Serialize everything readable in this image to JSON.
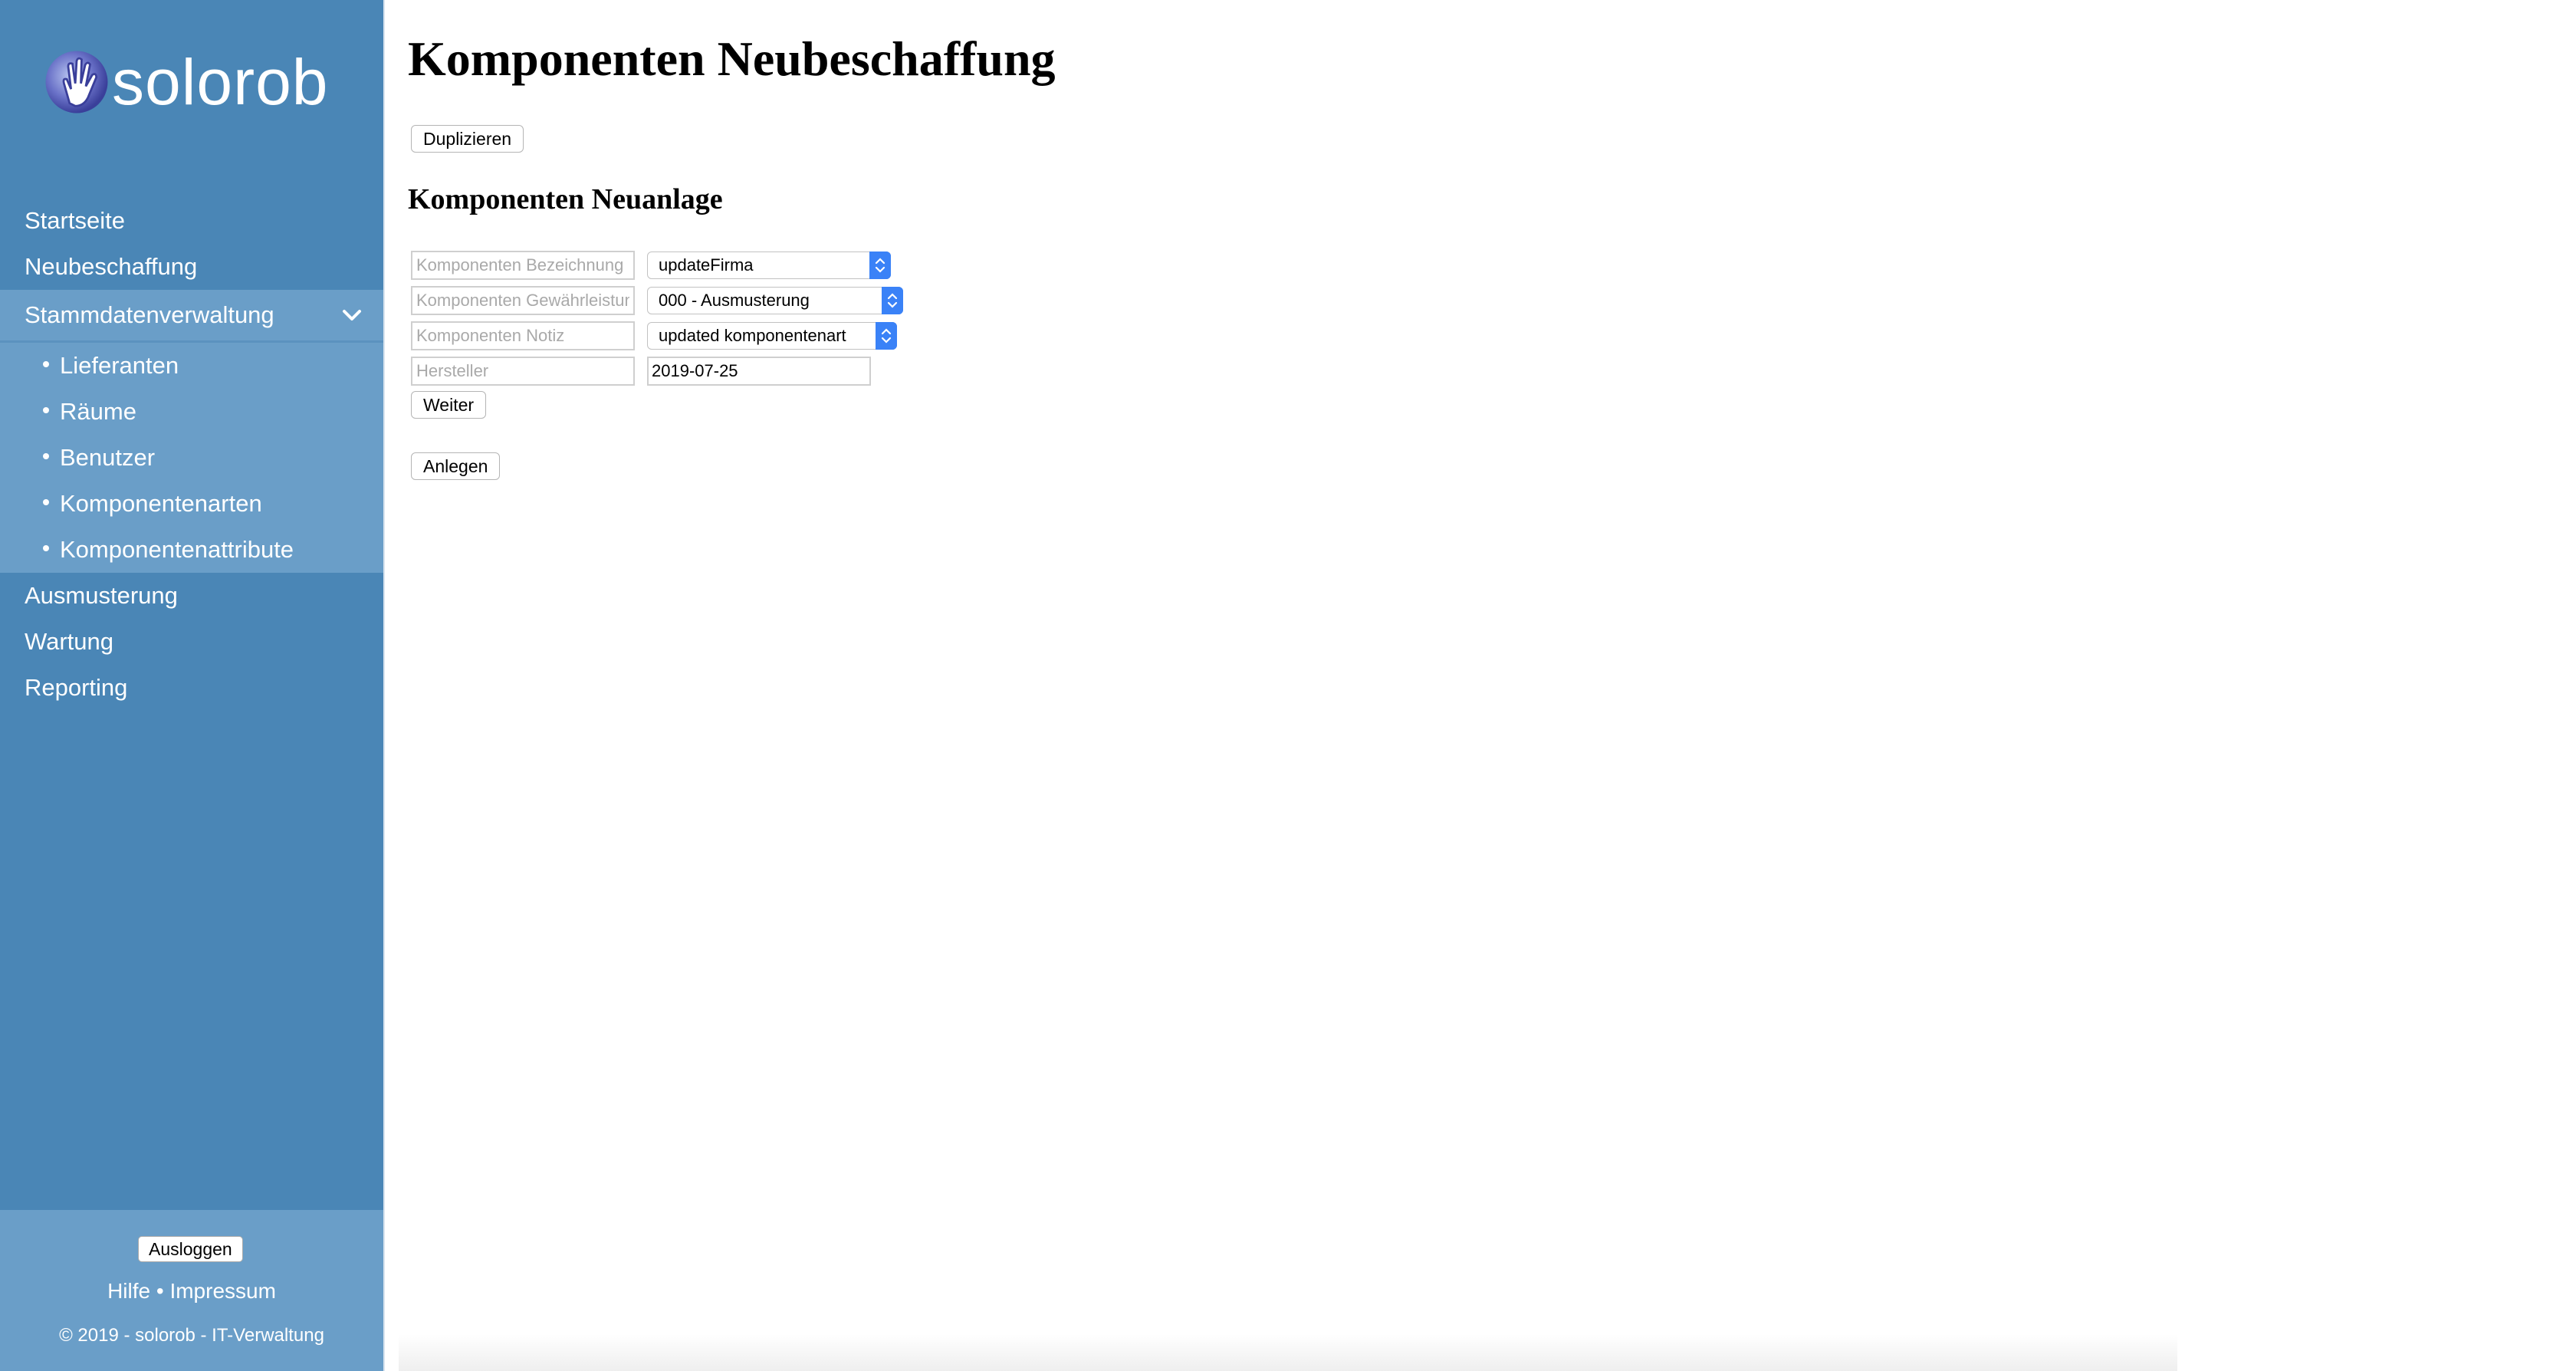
{
  "sidebar": {
    "logo_text": "solorob",
    "nav": [
      {
        "label": "Startseite"
      },
      {
        "label": "Neubeschaffung"
      },
      {
        "label": "Stammdatenverwaltung",
        "active": true
      }
    ],
    "subnav": [
      {
        "label": "Lieferanten"
      },
      {
        "label": "Räume"
      },
      {
        "label": "Benutzer"
      },
      {
        "label": "Komponentenarten"
      },
      {
        "label": "Komponentenattribute"
      }
    ],
    "nav_after": [
      {
        "label": "Ausmusterung"
      },
      {
        "label": "Wartung"
      },
      {
        "label": "Reporting"
      }
    ],
    "logout_label": "Ausloggen",
    "help_label": "Hilfe",
    "separator": "•",
    "imprint_label": "Impressum",
    "copyright": "© 2019 - solorob - IT-Verwaltung"
  },
  "main": {
    "title": "Komponenten Neubeschaffung",
    "duplicate_label": "Duplizieren",
    "section_title": "Komponenten Neuanlage",
    "form": {
      "name_placeholder": "Komponenten Bezeichnung",
      "warranty_placeholder": "Komponenten Gewährleistung",
      "note_placeholder": "Komponenten Notiz",
      "manufacturer_placeholder": "Hersteller",
      "supplier_select": "updateFirma",
      "room_select": "000 - Ausmusterung",
      "type_select": "updated komponentenart",
      "date_value": "2019-07-25",
      "next_label": "Weiter",
      "create_label": "Anlegen"
    }
  },
  "colors": {
    "sidebar_bg": "#4a86b6",
    "sidebar_active_bg": "#6a9ec8",
    "select_accent": "#3a82f7"
  }
}
